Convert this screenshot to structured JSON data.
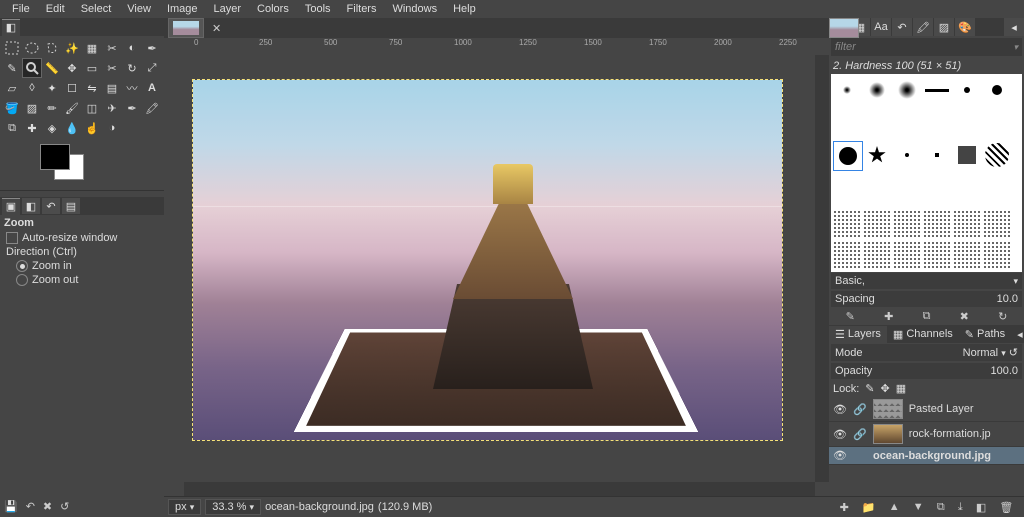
{
  "menubar": [
    "File",
    "Edit",
    "Select",
    "View",
    "Image",
    "Layer",
    "Colors",
    "Tools",
    "Filters",
    "Windows",
    "Help"
  ],
  "ruler_h": [
    "0",
    "250",
    "500",
    "750",
    "1000",
    "1250",
    "1500",
    "1750",
    "2000",
    "2250"
  ],
  "tool_options": {
    "title": "Zoom",
    "auto_resize": "Auto-resize window",
    "direction": "Direction  (Ctrl)",
    "zoom_in": "Zoom in",
    "zoom_out": "Zoom out"
  },
  "statusbar": {
    "unit": "px",
    "zoom": "33.3 %",
    "file": "ocean-background.jpg",
    "size": "(120.9 MB)"
  },
  "brushes": {
    "filter": "filter",
    "title": "2. Hardness 100 (51 × 51)",
    "preset": "Basic,",
    "spacing_label": "Spacing",
    "spacing_value": "10.0"
  },
  "layer_tabs": {
    "layers": "Layers",
    "channels": "Channels",
    "paths": "Paths"
  },
  "layers_panel": {
    "mode_label": "Mode",
    "mode_value": "Normal",
    "opacity_label": "Opacity",
    "opacity_value": "100.0",
    "lock_label": "Lock:"
  },
  "layers": [
    {
      "name": "Pasted Layer",
      "thumb": "checker",
      "selected": false
    },
    {
      "name": "rock-formation.jp",
      "thumb": "rock",
      "selected": false
    },
    {
      "name": "ocean-background.jpg",
      "thumb": "ocean",
      "selected": true
    }
  ]
}
